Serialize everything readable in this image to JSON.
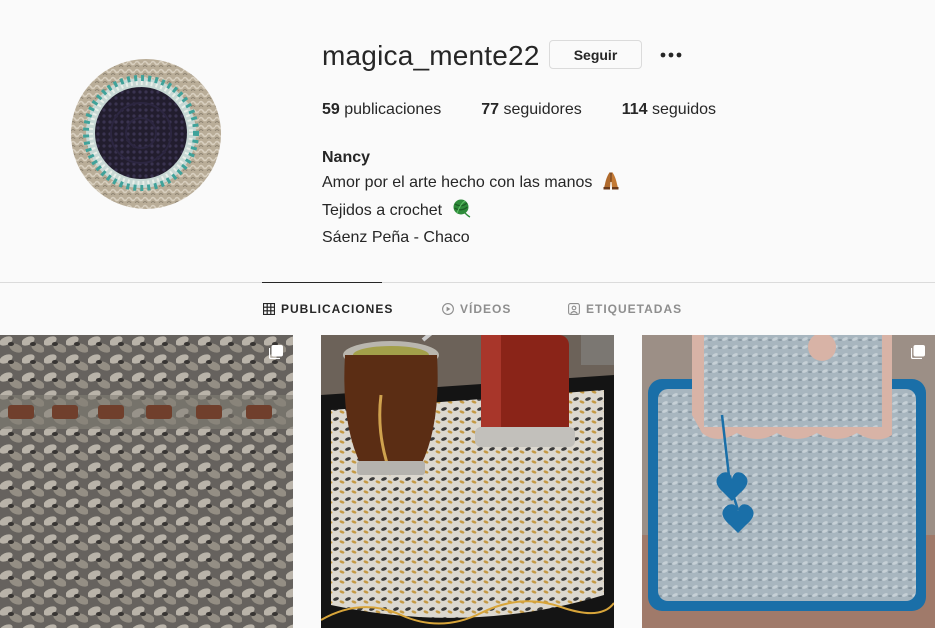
{
  "profile": {
    "username": "magica_mente22",
    "follow_label": "Seguir",
    "more_icon": "more-horizontal-icon",
    "stats": {
      "posts_count": "59",
      "posts_label": "publicaciones",
      "followers_count": "77",
      "followers_label": "seguidores",
      "following_count": "114",
      "following_label": "seguidos"
    },
    "bio": {
      "name": "Nancy",
      "line1": "Amor por el arte hecho con las manos",
      "line1_emoji": "folded-hands-icon",
      "line2": "Tejidos a crochet",
      "line2_emoji": "yarn-ball-icon",
      "line3": "Sáenz Peña - Chaco"
    }
  },
  "tabs": [
    {
      "label": "PUBLICACIONES",
      "icon": "grid-icon",
      "active": true
    },
    {
      "label": "VÍDEOS",
      "icon": "play-icon",
      "active": false
    },
    {
      "label": "ETIQUETADAS",
      "icon": "tagged-icon",
      "active": false
    }
  ],
  "posts": [
    {
      "description_icon": "crochet-closeup-photo",
      "multi": true
    },
    {
      "description_icon": "mate-on-crochet-photo",
      "multi": false
    },
    {
      "description_icon": "blue-crochet-bag-photo",
      "multi": true
    }
  ],
  "colors": {
    "background": "#fafafa",
    "text": "#262626",
    "muted": "#8e8e8e",
    "border": "#dbdbdb"
  }
}
